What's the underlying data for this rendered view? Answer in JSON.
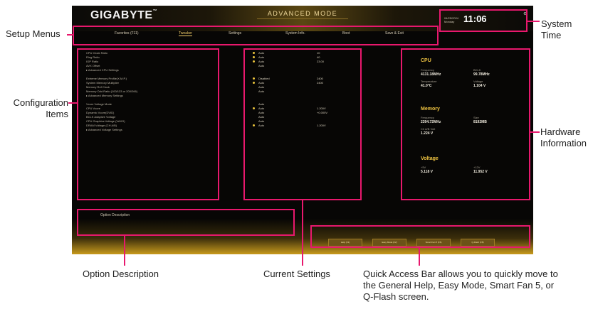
{
  "bios": {
    "logo": "GIGABYTE",
    "logo_tm": "™",
    "mode_title": "ADVANCED MODE",
    "date": "04/25/2024",
    "day": "Monday",
    "time": "11:06",
    "menus": [
      {
        "label": "Favorites (F11)",
        "active": false
      },
      {
        "label": "Tweaker",
        "active": true
      },
      {
        "label": "Settings",
        "active": false
      },
      {
        "label": "System Info.",
        "active": false
      },
      {
        "label": "Boot",
        "active": false
      },
      {
        "label": "Save & Exit",
        "active": false
      }
    ],
    "config_items": [
      {
        "label": "CPU Clock Ratio"
      },
      {
        "label": "Ring Ratio"
      },
      {
        "label": "IGP Ratio"
      },
      {
        "label": "AVX Offset"
      },
      {
        "label": "▸ Advanced CPU Settings"
      },
      {
        "label": ""
      },
      {
        "label": "Extreme Memory Profile(X.M.P.)"
      },
      {
        "label": "System Memory Multiplier"
      },
      {
        "label": "Memory Ref Clock"
      },
      {
        "label": "Memory Odd Ratio (100/133 or 200/266)"
      },
      {
        "label": "▸ Advanced Memory Settings"
      },
      {
        "label": ""
      },
      {
        "label": "Vcore Voltage Mode"
      },
      {
        "label": "CPU Vcore"
      },
      {
        "label": "Dynamic Vcore(DVID)"
      },
      {
        "label": "BCLK Adaptive Voltage"
      },
      {
        "label": "CPU Graphics Voltage (VAXG)"
      },
      {
        "label": "DRAM Voltage (CH A/B)"
      },
      {
        "label": "▸ Advanced Voltage Settings"
      }
    ],
    "current_settings": [
      {
        "value": "Auto",
        "value2": "10",
        "dot": true
      },
      {
        "value": "Auto",
        "value2": "40",
        "dot": true
      },
      {
        "value": "Auto",
        "value2": "23.00",
        "dot": true
      },
      {
        "value": "Auto",
        "value2": "",
        "dot": false
      },
      {
        "value": "",
        "value2": "",
        "dot": false
      },
      {
        "value": "",
        "value2": "",
        "dot": false
      },
      {
        "value": "Disabled",
        "value2": "2400",
        "dot": true
      },
      {
        "value": "Auto",
        "value2": "2400",
        "dot": true
      },
      {
        "value": "Auto",
        "value2": "",
        "dot": false
      },
      {
        "value": "Auto",
        "value2": "",
        "dot": false
      },
      {
        "value": "",
        "value2": "",
        "dot": false
      },
      {
        "value": "",
        "value2": "",
        "dot": false
      },
      {
        "value": "Auto",
        "value2": "",
        "dot": false
      },
      {
        "value": "Auto",
        "value2": "1.200V",
        "dot": true
      },
      {
        "value": "Auto",
        "value2": "+0.000V",
        "dot": false
      },
      {
        "value": "Auto",
        "value2": "",
        "dot": false
      },
      {
        "value": "Auto",
        "value2": "",
        "dot": false
      },
      {
        "value": "Auto",
        "value2": "1.200V",
        "dot": true
      }
    ],
    "hardware": {
      "cpu_title": "CPU",
      "freq_label": "Frequency",
      "freq_value": "4131.18MHz",
      "bclk_label": "BCLK",
      "bclk_value": "99.78MHz",
      "temp_label": "Temperature",
      "temp_value": "41.0°C",
      "volt_label": "Voltage",
      "volt_value": "1.104 V",
      "mem_title": "Memory",
      "mem_freq_label": "Frequency",
      "mem_freq_value": "2394.72MHz",
      "size_label": "Size",
      "size_value": "8192MB",
      "ch_label": "Ch A/B Volt",
      "ch_value": "1.224 V",
      "volt_title": "Voltage",
      "v5_label": "+5V",
      "v5_value": "5.118 V",
      "v12_label": "+12V",
      "v12_value": "11.952 V"
    },
    "option_description": "Option Description",
    "quick_access": [
      {
        "label": "Help (F1)"
      },
      {
        "label": "Easy Mode (F2)"
      },
      {
        "label": "Smart Fan 5 (F6)"
      },
      {
        "label": "Q-Flash (F8)"
      }
    ]
  },
  "callouts": {
    "setup_menus": "Setup Menus",
    "system_time_1": "System",
    "system_time_2": "Time",
    "config_items_1": "Configuration",
    "config_items_2": "Items",
    "hardware_info_1": "Hardware",
    "hardware_info_2": "Information",
    "option_description": "Option Description",
    "current_settings": "Current Settings",
    "quick_access_1": "Quick Access Bar allows you to quickly move to",
    "quick_access_2": "the General Help, Easy Mode, Smart Fan 5, or",
    "quick_access_3": "Q-Flash screen."
  },
  "colors": {
    "highlight": "#e8186d",
    "accent_gold": "#f1c542",
    "bios_bg": "#070605"
  }
}
